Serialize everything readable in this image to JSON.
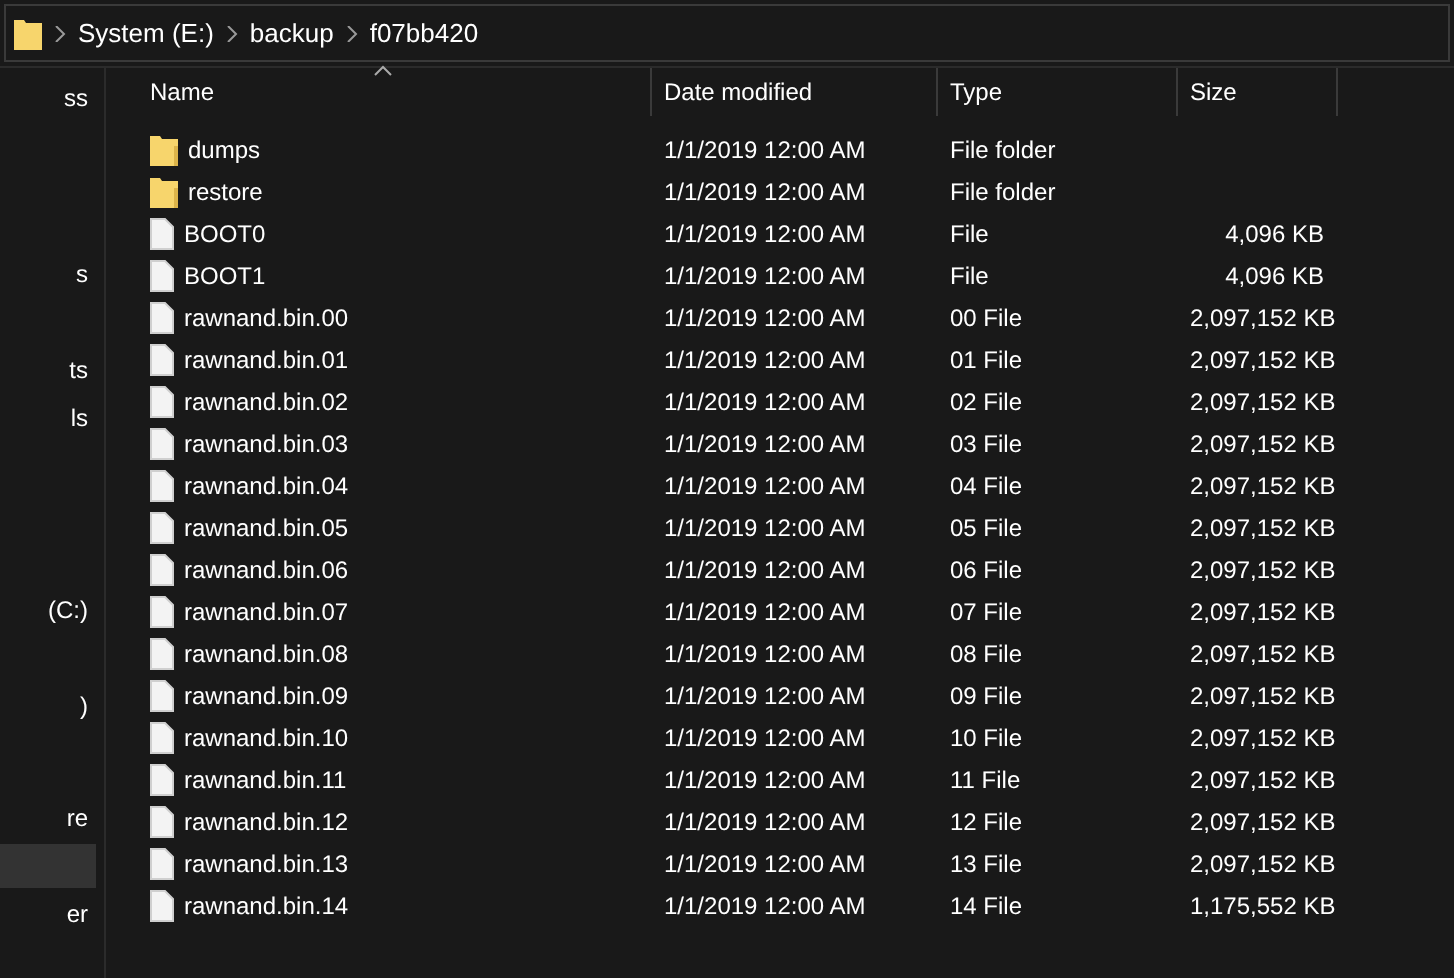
{
  "address_bar": {
    "crumbs": [
      "System (E:)",
      "backup",
      "f07bb420"
    ]
  },
  "sidebar": {
    "items": [
      {
        "label": "ss",
        "selected": false
      },
      {
        "label": "s",
        "selected": false
      },
      {
        "label": "ts",
        "selected": false
      },
      {
        "label": "ls",
        "selected": false
      },
      {
        "label": "(C:)",
        "selected": false
      },
      {
        "label": ")",
        "selected": false
      },
      {
        "label": "re",
        "selected": false
      },
      {
        "selected": true
      },
      {
        "label": "er",
        "selected": false
      }
    ]
  },
  "table": {
    "columns": [
      {
        "label": "Name",
        "sorted": true
      },
      {
        "label": "Date modified",
        "sorted": false
      },
      {
        "label": "Type",
        "sorted": false
      },
      {
        "label": "Size",
        "sorted": false
      }
    ],
    "rows": [
      {
        "kind": "folder",
        "name": "dumps",
        "date": "1/1/2019 12:00 AM",
        "type": "File folder"
      },
      {
        "kind": "folder",
        "name": "restore",
        "date": "1/1/2019 12:00 AM",
        "type": "File folder"
      },
      {
        "kind": "file",
        "name": "BOOT0",
        "date": "1/1/2019 12:00 AM",
        "type": "File",
        "size": "4,096 KB"
      },
      {
        "kind": "file",
        "name": "BOOT1",
        "date": "1/1/2019 12:00 AM",
        "type": "File",
        "size": "4,096 KB"
      },
      {
        "kind": "file",
        "name": "rawnand.bin.00",
        "date": "1/1/2019 12:00 AM",
        "type": "00 File",
        "size": "2,097,152 KB"
      },
      {
        "kind": "file",
        "name": "rawnand.bin.01",
        "date": "1/1/2019 12:00 AM",
        "type": "01 File",
        "size": "2,097,152 KB"
      },
      {
        "kind": "file",
        "name": "rawnand.bin.02",
        "date": "1/1/2019 12:00 AM",
        "type": "02 File",
        "size": "2,097,152 KB"
      },
      {
        "kind": "file",
        "name": "rawnand.bin.03",
        "date": "1/1/2019 12:00 AM",
        "type": "03 File",
        "size": "2,097,152 KB"
      },
      {
        "kind": "file",
        "name": "rawnand.bin.04",
        "date": "1/1/2019 12:00 AM",
        "type": "04 File",
        "size": "2,097,152 KB"
      },
      {
        "kind": "file",
        "name": "rawnand.bin.05",
        "date": "1/1/2019 12:00 AM",
        "type": "05 File",
        "size": "2,097,152 KB"
      },
      {
        "kind": "file",
        "name": "rawnand.bin.06",
        "date": "1/1/2019 12:00 AM",
        "type": "06 File",
        "size": "2,097,152 KB"
      },
      {
        "kind": "file",
        "name": "rawnand.bin.07",
        "date": "1/1/2019 12:00 AM",
        "type": "07 File",
        "size": "2,097,152 KB"
      },
      {
        "kind": "file",
        "name": "rawnand.bin.08",
        "date": "1/1/2019 12:00 AM",
        "type": "08 File",
        "size": "2,097,152 KB"
      },
      {
        "kind": "file",
        "name": "rawnand.bin.09",
        "date": "1/1/2019 12:00 AM",
        "type": "09 File",
        "size": "2,097,152 KB"
      },
      {
        "kind": "file",
        "name": "rawnand.bin.10",
        "date": "1/1/2019 12:00 AM",
        "type": "10 File",
        "size": "2,097,152 KB"
      },
      {
        "kind": "file",
        "name": "rawnand.bin.11",
        "date": "1/1/2019 12:00 AM",
        "type": "11 File",
        "size": "2,097,152 KB"
      },
      {
        "kind": "file",
        "name": "rawnand.bin.12",
        "date": "1/1/2019 12:00 AM",
        "type": "12 File",
        "size": "2,097,152 KB"
      },
      {
        "kind": "file",
        "name": "rawnand.bin.13",
        "date": "1/1/2019 12:00 AM",
        "type": "13 File",
        "size": "2,097,152 KB"
      },
      {
        "kind": "file",
        "name": "rawnand.bin.14",
        "date": "1/1/2019 12:00 AM",
        "type": "14 File",
        "size": "1,175,552 KB"
      }
    ]
  }
}
